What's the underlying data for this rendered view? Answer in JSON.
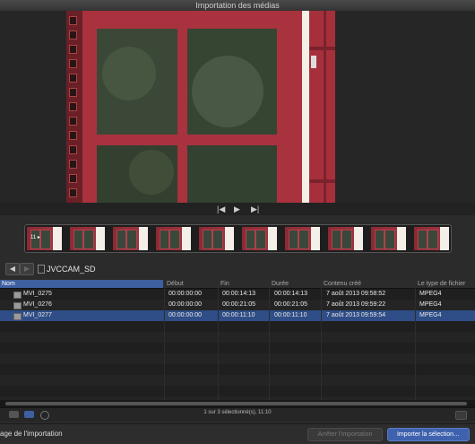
{
  "window": {
    "title": "Importation des médias"
  },
  "transport": {
    "prev_icon": "skip-back-icon",
    "play_icon": "play-icon",
    "next_icon": "skip-forward-icon"
  },
  "filmstrip": {
    "first_thumb_label": "11 ▸"
  },
  "path": {
    "folder": "JVCCAM_SD",
    "back_label": "◀",
    "fwd_label": "▶"
  },
  "table": {
    "columns": [
      "Nom",
      "Début",
      "Fin",
      "Durée",
      "Contenu créé",
      "Le type de fichier"
    ],
    "rows": [
      {
        "name": "MVI_0275",
        "start": "00:00:00:00",
        "end": "00:00:14:13",
        "duration": "00:00:14:13",
        "created": "7 août 2013 09:58:52",
        "type": "MPEG4",
        "selected": false
      },
      {
        "name": "MVI_0276",
        "start": "00:00:00:00",
        "end": "00:00:21:05",
        "duration": "00:00:21:05",
        "created": "7 août 2013 09:59:22",
        "type": "MPEG4",
        "selected": false
      },
      {
        "name": "MVI_0277",
        "start": "00:00:00:00",
        "end": "00:00:11:10",
        "duration": "00:00:11:10",
        "created": "7 août 2013 09:59:54",
        "type": "MPEG4",
        "selected": true
      }
    ]
  },
  "status": {
    "text": "1 sur 3 sélectionné(s), 11:10"
  },
  "bottom": {
    "left_label": "age de l'importation",
    "stop_button": "Arrêter l'importation",
    "import_button": "Importer la sélection…"
  },
  "colors": {
    "selection": "#2f4d86",
    "accent": "#3e5fa0",
    "door_red": "#a8323e"
  }
}
